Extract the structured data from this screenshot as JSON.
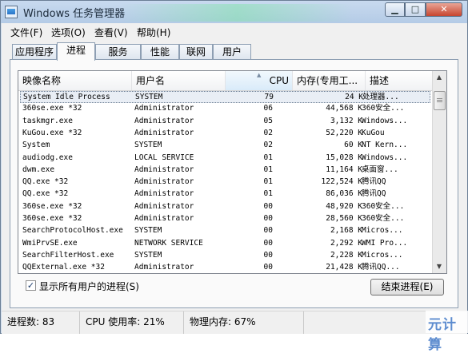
{
  "window": {
    "title": "Windows 任务管理器",
    "minimize_label": "▁",
    "maximize_label": "□",
    "close_label": "✕"
  },
  "menu": [
    "文件(F)",
    "选项(O)",
    "查看(V)",
    "帮助(H)"
  ],
  "tabs": [
    {
      "label": "应用程序",
      "active": false
    },
    {
      "label": "进程",
      "active": true
    },
    {
      "label": "服务",
      "active": false
    },
    {
      "label": "性能",
      "active": false
    },
    {
      "label": "联网",
      "active": false
    },
    {
      "label": "用户",
      "active": false
    }
  ],
  "columns": [
    "映像名称",
    "用户名",
    "CPU",
    "内存(专用工...",
    "描述"
  ],
  "sorted_column": "CPU",
  "processes": [
    {
      "name": "System Idle Process",
      "user": "SYSTEM",
      "cpu": "79",
      "mem": "24 K",
      "desc": "处理器..."
    },
    {
      "name": "360se.exe *32",
      "user": "Administrator",
      "cpu": "06",
      "mem": "44,568 K",
      "desc": "360安全..."
    },
    {
      "name": "taskmgr.exe",
      "user": "Administrator",
      "cpu": "05",
      "mem": "3,132 K",
      "desc": "Windows..."
    },
    {
      "name": "KuGou.exe *32",
      "user": "Administrator",
      "cpu": "02",
      "mem": "52,220 K",
      "desc": "KuGou"
    },
    {
      "name": "System",
      "user": "SYSTEM",
      "cpu": "02",
      "mem": "60 K",
      "desc": "NT Kern..."
    },
    {
      "name": "audiodg.exe",
      "user": "LOCAL SERVICE",
      "cpu": "01",
      "mem": "15,028 K",
      "desc": "Windows..."
    },
    {
      "name": "dwm.exe",
      "user": "Administrator",
      "cpu": "01",
      "mem": "11,164 K",
      "desc": "桌面窗..."
    },
    {
      "name": "QQ.exe *32",
      "user": "Administrator",
      "cpu": "01",
      "mem": "122,524 K",
      "desc": "腾讯QQ"
    },
    {
      "name": "QQ.exe *32",
      "user": "Administrator",
      "cpu": "01",
      "mem": "86,036 K",
      "desc": "腾讯QQ"
    },
    {
      "name": "360se.exe *32",
      "user": "Administrator",
      "cpu": "00",
      "mem": "48,920 K",
      "desc": "360安全..."
    },
    {
      "name": "360se.exe *32",
      "user": "Administrator",
      "cpu": "00",
      "mem": "28,560 K",
      "desc": "360安全..."
    },
    {
      "name": "SearchProtocolHost.exe",
      "user": "SYSTEM",
      "cpu": "00",
      "mem": "2,168 K",
      "desc": "Micros..."
    },
    {
      "name": "WmiPrvSE.exe",
      "user": "NETWORK SERVICE",
      "cpu": "00",
      "mem": "2,292 K",
      "desc": "WMI Pro..."
    },
    {
      "name": "SearchFilterHost.exe",
      "user": "SYSTEM",
      "cpu": "00",
      "mem": "2,228 K",
      "desc": "Micros..."
    },
    {
      "name": "QQExternal.exe *32",
      "user": "Administrator",
      "cpu": "00",
      "mem": "21,428 K",
      "desc": "腾讯QQ..."
    }
  ],
  "selected_process_index": 0,
  "show_all_users": {
    "label": "显示所有用户的进程(S)",
    "checked": true
  },
  "end_process_button": "结束进程(E)",
  "status": {
    "processes": "进程数: 83",
    "cpu": "CPU 使用率: 21%",
    "memory": "物理内存: 67%"
  },
  "watermark": "元计算"
}
